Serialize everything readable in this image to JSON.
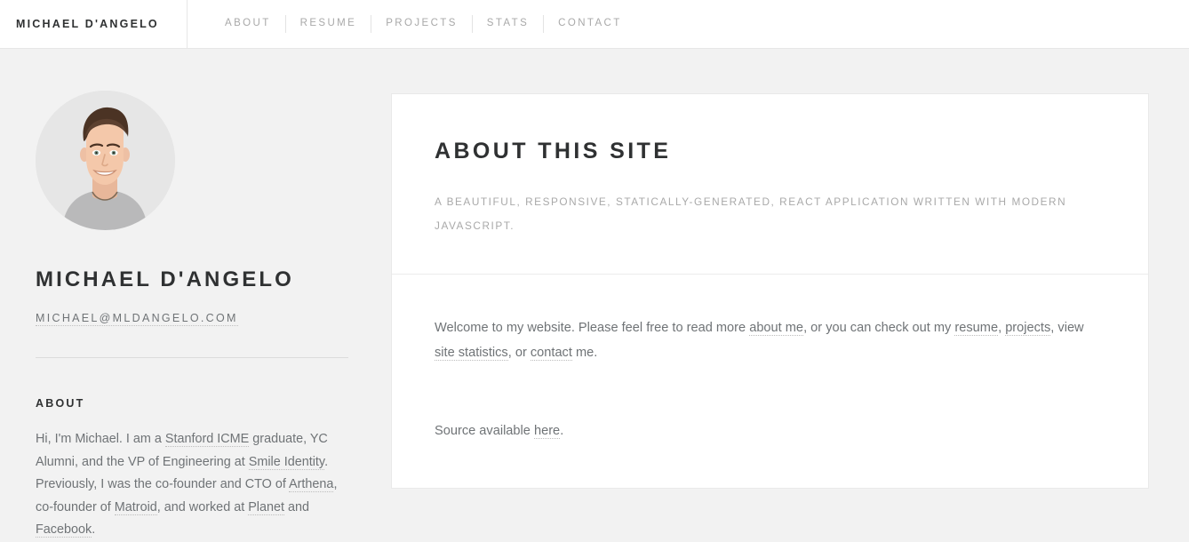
{
  "header": {
    "brand": "MICHAEL D'ANGELO",
    "nav": [
      {
        "label": "ABOUT"
      },
      {
        "label": "RESUME"
      },
      {
        "label": "PROJECTS"
      },
      {
        "label": "STATS"
      },
      {
        "label": "CONTACT"
      }
    ]
  },
  "sidebar": {
    "avatar_alt": "portrait-photo",
    "name": "MICHAEL D'ANGELO",
    "email": "MICHAEL@MLDANGELO.COM",
    "about_heading": "ABOUT",
    "bio": {
      "s1": "Hi, I'm Michael. I am a ",
      "l1": "Stanford ICME",
      "s2": " graduate, YC Alumni, and the VP of Engineering at ",
      "l2": "Smile Identity",
      "s3": ". Previously, I was the co-founder and CTO of ",
      "l3": "Arthena",
      "s4": ", co-founder of ",
      "l4": "Matroid",
      "s5": ", and worked at ",
      "l5": "Planet",
      "s6": " and ",
      "l6": "Facebook",
      "s7": "."
    }
  },
  "main": {
    "title": "ABOUT THIS SITE",
    "subtitle": "A BEAUTIFUL, RESPONSIVE, STATICALLY-GENERATED, REACT APPLICATION WRITTEN WITH MODERN JAVASCRIPT.",
    "welcome": {
      "s1": "Welcome to my website. Please feel free to read more ",
      "l1": "about me",
      "s2": ", or you can check out my ",
      "l2": "resume",
      "s3": ", ",
      "l3": "projects",
      "s4": ", view ",
      "l4": "site statistics",
      "s5": ", or ",
      "l5": "contact",
      "s6": " me."
    },
    "source": {
      "s1": "Source available ",
      "l1": "here",
      "s2": "."
    }
  },
  "colors": {
    "page_bg": "#f2f2f2",
    "card_bg": "#ffffff",
    "heading": "#2f3132",
    "body_text": "#6f7376",
    "muted": "#a9a9a9",
    "border": "#e9e9e9"
  }
}
